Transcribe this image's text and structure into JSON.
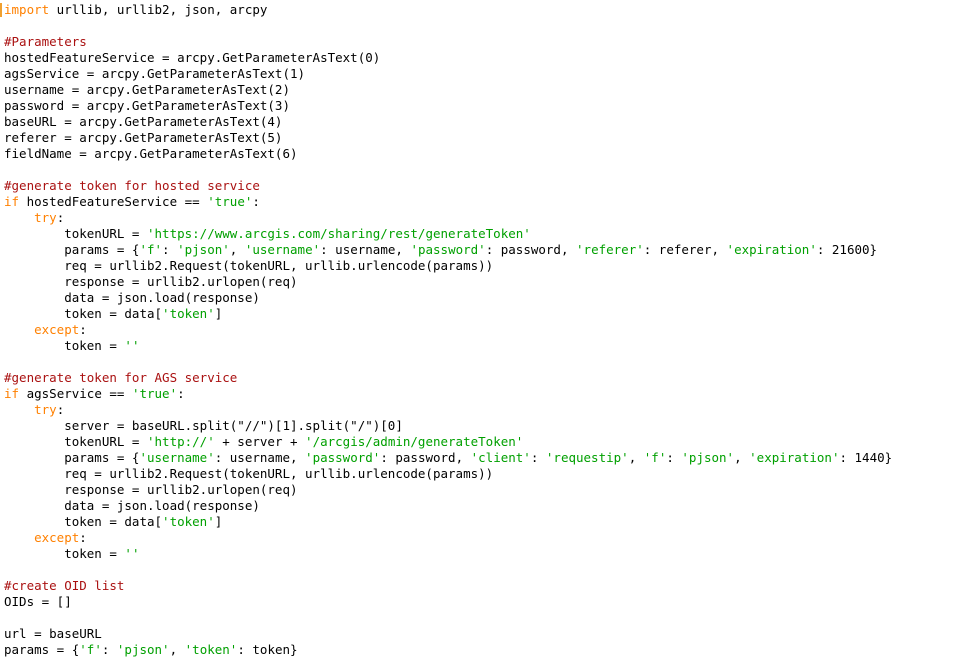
{
  "editor": {
    "name": "python-code-editor",
    "language": "Python",
    "background_color": "#ffffff",
    "caret": {
      "visible": true,
      "line": 1,
      "column": 1,
      "color": "#f0a030"
    },
    "colors": {
      "keyword": "#ff8000",
      "comment": "#aa1111",
      "string": "#00a000",
      "plain": "#000000",
      "background": "#ffffff"
    }
  },
  "code": {
    "lines": [
      [
        {
          "t": "import",
          "c": "kw"
        },
        {
          "t": " urllib, urllib2, json, arcpy",
          "c": "plain"
        }
      ],
      [
        {
          "t": "",
          "c": "plain"
        }
      ],
      [
        {
          "t": "#Parameters",
          "c": "com"
        }
      ],
      [
        {
          "t": "hostedFeatureService = arcpy.GetParameterAsText(0)",
          "c": "plain"
        }
      ],
      [
        {
          "t": "agsService = arcpy.GetParameterAsText(1)",
          "c": "plain"
        }
      ],
      [
        {
          "t": "username = arcpy.GetParameterAsText(2)",
          "c": "plain"
        }
      ],
      [
        {
          "t": "password = arcpy.GetParameterAsText(3)",
          "c": "plain"
        }
      ],
      [
        {
          "t": "baseURL = arcpy.GetParameterAsText(4)",
          "c": "plain"
        }
      ],
      [
        {
          "t": "referer = arcpy.GetParameterAsText(5)",
          "c": "plain"
        }
      ],
      [
        {
          "t": "fieldName = arcpy.GetParameterAsText(6)",
          "c": "plain"
        }
      ],
      [
        {
          "t": "",
          "c": "plain"
        }
      ],
      [
        {
          "t": "#generate token for hosted service",
          "c": "com"
        }
      ],
      [
        {
          "t": "if",
          "c": "kw"
        },
        {
          "t": " hostedFeatureService == ",
          "c": "plain"
        },
        {
          "t": "'true'",
          "c": "str"
        },
        {
          "t": ":",
          "c": "plain"
        }
      ],
      [
        {
          "t": "    ",
          "c": "plain"
        },
        {
          "t": "try",
          "c": "kw"
        },
        {
          "t": ":",
          "c": "plain"
        }
      ],
      [
        {
          "t": "        tokenURL = ",
          "c": "plain"
        },
        {
          "t": "'https://www.arcgis.com/sharing/rest/generateToken'",
          "c": "str"
        }
      ],
      [
        {
          "t": "        params = {",
          "c": "plain"
        },
        {
          "t": "'f'",
          "c": "str"
        },
        {
          "t": ": ",
          "c": "plain"
        },
        {
          "t": "'pjson'",
          "c": "str"
        },
        {
          "t": ", ",
          "c": "plain"
        },
        {
          "t": "'username'",
          "c": "str"
        },
        {
          "t": ": username, ",
          "c": "plain"
        },
        {
          "t": "'password'",
          "c": "str"
        },
        {
          "t": ": password, ",
          "c": "plain"
        },
        {
          "t": "'referer'",
          "c": "str"
        },
        {
          "t": ": referer, ",
          "c": "plain"
        },
        {
          "t": "'expiration'",
          "c": "str"
        },
        {
          "t": ": 21600}",
          "c": "plain"
        }
      ],
      [
        {
          "t": "        req = urllib2.Request(tokenURL, urllib.urlencode(params))",
          "c": "plain"
        }
      ],
      [
        {
          "t": "        response = urllib2.urlopen(req)",
          "c": "plain"
        }
      ],
      [
        {
          "t": "        data = json.load(response)",
          "c": "plain"
        }
      ],
      [
        {
          "t": "        token = data[",
          "c": "plain"
        },
        {
          "t": "'token'",
          "c": "str"
        },
        {
          "t": "]",
          "c": "plain"
        }
      ],
      [
        {
          "t": "    ",
          "c": "plain"
        },
        {
          "t": "except",
          "c": "kw"
        },
        {
          "t": ":",
          "c": "plain"
        }
      ],
      [
        {
          "t": "        token = ",
          "c": "plain"
        },
        {
          "t": "''",
          "c": "str"
        }
      ],
      [
        {
          "t": "",
          "c": "plain"
        }
      ],
      [
        {
          "t": "#generate token for AGS service",
          "c": "com"
        }
      ],
      [
        {
          "t": "if",
          "c": "kw"
        },
        {
          "t": " agsService == ",
          "c": "plain"
        },
        {
          "t": "'true'",
          "c": "str"
        },
        {
          "t": ":",
          "c": "plain"
        }
      ],
      [
        {
          "t": "    ",
          "c": "plain"
        },
        {
          "t": "try",
          "c": "kw"
        },
        {
          "t": ":",
          "c": "plain"
        }
      ],
      [
        {
          "t": "        server = baseURL.split(\"//\")[1].split(\"/\")[0]",
          "c": "plain"
        }
      ],
      [
        {
          "t": "        tokenURL = ",
          "c": "plain"
        },
        {
          "t": "'http://'",
          "c": "str"
        },
        {
          "t": " + server + ",
          "c": "plain"
        },
        {
          "t": "'/arcgis/admin/generateToken'",
          "c": "str"
        }
      ],
      [
        {
          "t": "        params = {",
          "c": "plain"
        },
        {
          "t": "'username'",
          "c": "str"
        },
        {
          "t": ": username, ",
          "c": "plain"
        },
        {
          "t": "'password'",
          "c": "str"
        },
        {
          "t": ": password, ",
          "c": "plain"
        },
        {
          "t": "'client'",
          "c": "str"
        },
        {
          "t": ": ",
          "c": "plain"
        },
        {
          "t": "'requestip'",
          "c": "str"
        },
        {
          "t": ", ",
          "c": "plain"
        },
        {
          "t": "'f'",
          "c": "str"
        },
        {
          "t": ": ",
          "c": "plain"
        },
        {
          "t": "'pjson'",
          "c": "str"
        },
        {
          "t": ", ",
          "c": "plain"
        },
        {
          "t": "'expiration'",
          "c": "str"
        },
        {
          "t": ": 1440}",
          "c": "plain"
        }
      ],
      [
        {
          "t": "        req = urllib2.Request(tokenURL, urllib.urlencode(params))",
          "c": "plain"
        }
      ],
      [
        {
          "t": "        response = urllib2.urlopen(req)",
          "c": "plain"
        }
      ],
      [
        {
          "t": "        data = json.load(response)",
          "c": "plain"
        }
      ],
      [
        {
          "t": "        token = data[",
          "c": "plain"
        },
        {
          "t": "'token'",
          "c": "str"
        },
        {
          "t": "]",
          "c": "plain"
        }
      ],
      [
        {
          "t": "    ",
          "c": "plain"
        },
        {
          "t": "except",
          "c": "kw"
        },
        {
          "t": ":",
          "c": "plain"
        }
      ],
      [
        {
          "t": "        token = ",
          "c": "plain"
        },
        {
          "t": "''",
          "c": "str"
        }
      ],
      [
        {
          "t": "",
          "c": "plain"
        }
      ],
      [
        {
          "t": "#create OID list",
          "c": "com"
        }
      ],
      [
        {
          "t": "OIDs = []",
          "c": "plain"
        }
      ],
      [
        {
          "t": "",
          "c": "plain"
        }
      ],
      [
        {
          "t": "url = baseURL",
          "c": "plain"
        }
      ],
      [
        {
          "t": "params = {",
          "c": "plain"
        },
        {
          "t": "'f'",
          "c": "str"
        },
        {
          "t": ": ",
          "c": "plain"
        },
        {
          "t": "'pjson'",
          "c": "str"
        },
        {
          "t": ", ",
          "c": "plain"
        },
        {
          "t": "'token'",
          "c": "str"
        },
        {
          "t": ": token}",
          "c": "plain"
        }
      ]
    ]
  }
}
